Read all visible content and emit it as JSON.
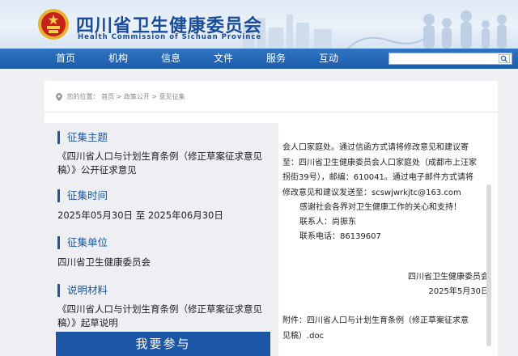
{
  "header": {
    "title_cn": "四川省卫生健康委员会",
    "title_en": "Health Commission of Sichuan Province"
  },
  "nav": {
    "items": [
      "首页",
      "机构",
      "信息",
      "文件",
      "服务",
      "互动"
    ],
    "search_value": ""
  },
  "breadcrumb": {
    "prefix": "您的位置：",
    "path": "首页 > 政策公开 > 意见征集"
  },
  "sections": [
    {
      "title": "征集主题",
      "body": "《四川省人口与计划生育条例（修正草案征求意见稿）》公开征求意见"
    },
    {
      "title": "征集时间",
      "body": "2025年05月30日 至 2025年06月30日"
    },
    {
      "title": "征集单位",
      "body": "四川省卫生健康委员会"
    },
    {
      "title": "说明材料",
      "body": "《四川省人口与计划生育条例（修正草案征求意见稿）》起草说明"
    }
  ],
  "join_button": "我要参与",
  "right": {
    "mail_text": "会人口家庭处。通过信函方式请将修改意见和建议寄至：四川省卫生健康委员会人口家庭处（成都市上汪家拐街39号），邮编：610041。通过电子邮件方式请将修改意见和建议发送至：scswjwrkjtc@163.com",
    "thanks": "感谢社会各界对卫生健康工作的关心和支持！",
    "contact": "联系人：尚振东",
    "phone": "联系电话：86139607",
    "sign_org": "四川省卫生健康委员会",
    "sign_date": "2025年5月30日",
    "attachment": "附件：四川省人口与计划生育条例（修正草案征求意见稿）.doc"
  },
  "colors": {
    "brand_blue": "#1b57a6",
    "nav_blue": "#1c5cab",
    "emblem_red": "#c8201b",
    "emblem_gold": "#e8b22a"
  }
}
